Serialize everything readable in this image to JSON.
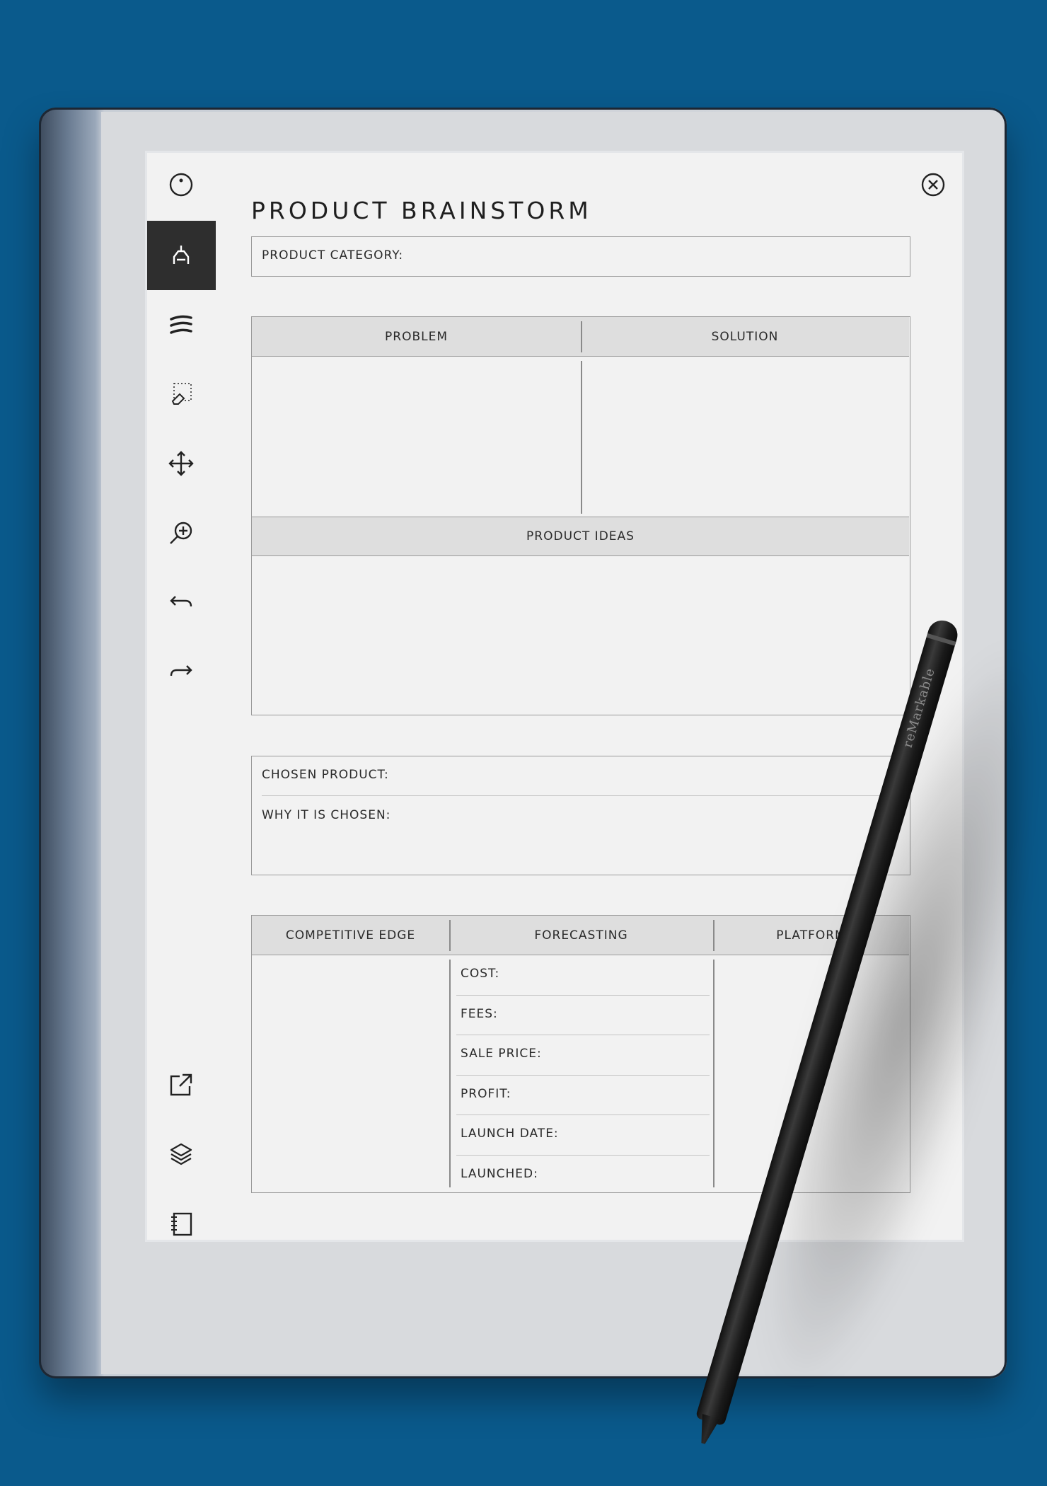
{
  "page": {
    "title": "PRODUCT BRAINSTORM",
    "product_category_label": "PRODUCT CATEGORY:",
    "problem_header": "PROBLEM",
    "solution_header": "SOLUTION",
    "product_ideas_header": "PRODUCT IDEAS",
    "chosen_product_label": "CHOSEN PRODUCT:",
    "why_chosen_label": "WHY IT IS CHOSEN:",
    "competitive_edge_header": "COMPETITIVE EDGE",
    "forecasting_header": "FORECASTING",
    "platform_header": "PLATFORM",
    "forecasting_items": [
      "COST:",
      "FEES:",
      "SALE PRICE:",
      "PROFIT:",
      "LAUNCH DATE:",
      "LAUNCHED:"
    ]
  },
  "toolbar": {
    "items": [
      {
        "icon": "menu-circle-icon"
      },
      {
        "icon": "pen-tool-icon",
        "active": true
      },
      {
        "icon": "stroke-thickness-icon"
      },
      {
        "icon": "eraser-select-icon"
      },
      {
        "icon": "move-icon"
      },
      {
        "icon": "zoom-icon"
      },
      {
        "icon": "undo-icon"
      },
      {
        "icon": "redo-icon"
      },
      {
        "icon": "share-icon"
      },
      {
        "icon": "layers-icon"
      },
      {
        "icon": "notebook-icon"
      }
    ]
  },
  "close": {
    "icon": "close-icon"
  },
  "stylus": {
    "brand": "reMarkable"
  },
  "colors": {
    "background": "#0a5a8c",
    "paper": "#f2f2f2",
    "header_fill": "#dedede"
  }
}
